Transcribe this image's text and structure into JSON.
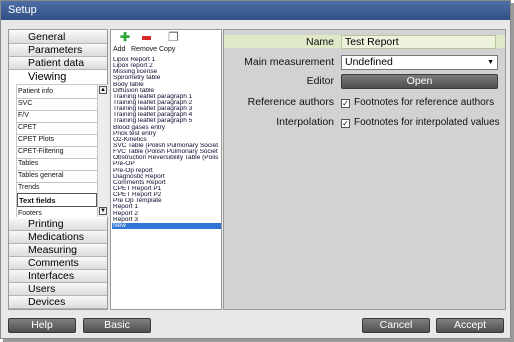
{
  "window": {
    "title": "Setup"
  },
  "nav": {
    "tabs_top": [
      "General",
      "Parameters",
      "Patient data"
    ],
    "active_tab": "Viewing",
    "sub_items": [
      "Patient info",
      "SVC",
      "F/V",
      "CPET",
      "CPET Plots",
      "CPET-Filtering",
      "Tables",
      "Tables general",
      "Trends",
      "Text fields",
      "Footers"
    ],
    "selected_sub_item": "Text fields",
    "tabs_bottom": [
      "Printing",
      "Medications",
      "Measuring",
      "Comments",
      "Interfaces",
      "Users",
      "Devices"
    ]
  },
  "toolbar": {
    "add_label": "Add",
    "remove_label": "Remove",
    "copy_label": "Copy"
  },
  "reports": [
    "Lipox Report 1",
    "Lipox report 2",
    "Missing license",
    "Spirometry table",
    "Body table",
    "Diffusion table",
    "Training leaflet paragraph 1",
    "Training leaflet paragraph 2",
    "Training leaflet paragraph 3",
    "Training leaflet paragraph 4",
    "Training leaflet paragraph 5",
    "Blood gases entry",
    "Prick test entry",
    "O2-Kinetics",
    "SVC Table (Polish Pulmonary Societ",
    "FVC Table (Polish Pulmonary Societ",
    "Obstruction Reversibility Table (Polis",
    "Pre-OP",
    "Pre-Op report",
    "Diagnostic Report",
    "Comments Report",
    "CPET Report P1",
    "CPET Report P2",
    "Pre Op Template",
    "Report 1",
    "Report 2",
    "Report 3",
    "New"
  ],
  "selected_report": "New",
  "properties": {
    "name_label": "Name",
    "name_value": "Test Report",
    "main_measurement_label": "Main measurement",
    "main_measurement_value": "Undefined",
    "editor_label": "Editor",
    "editor_button": "Open",
    "reference_authors_label": "Reference authors",
    "reference_authors_checkbox": "Footnotes for reference authors",
    "reference_authors_checked": true,
    "interpolation_label": "Interpolation",
    "interpolation_checkbox": "Footnotes for interpolated values",
    "interpolation_checked": true
  },
  "buttons": {
    "help": "Help",
    "basic": "Basic",
    "cancel": "Cancel",
    "accept": "Accept"
  },
  "colors": {
    "title_bar": "#3f5f95",
    "selection": "#3274d8",
    "name_field": "#dfe9c8"
  }
}
